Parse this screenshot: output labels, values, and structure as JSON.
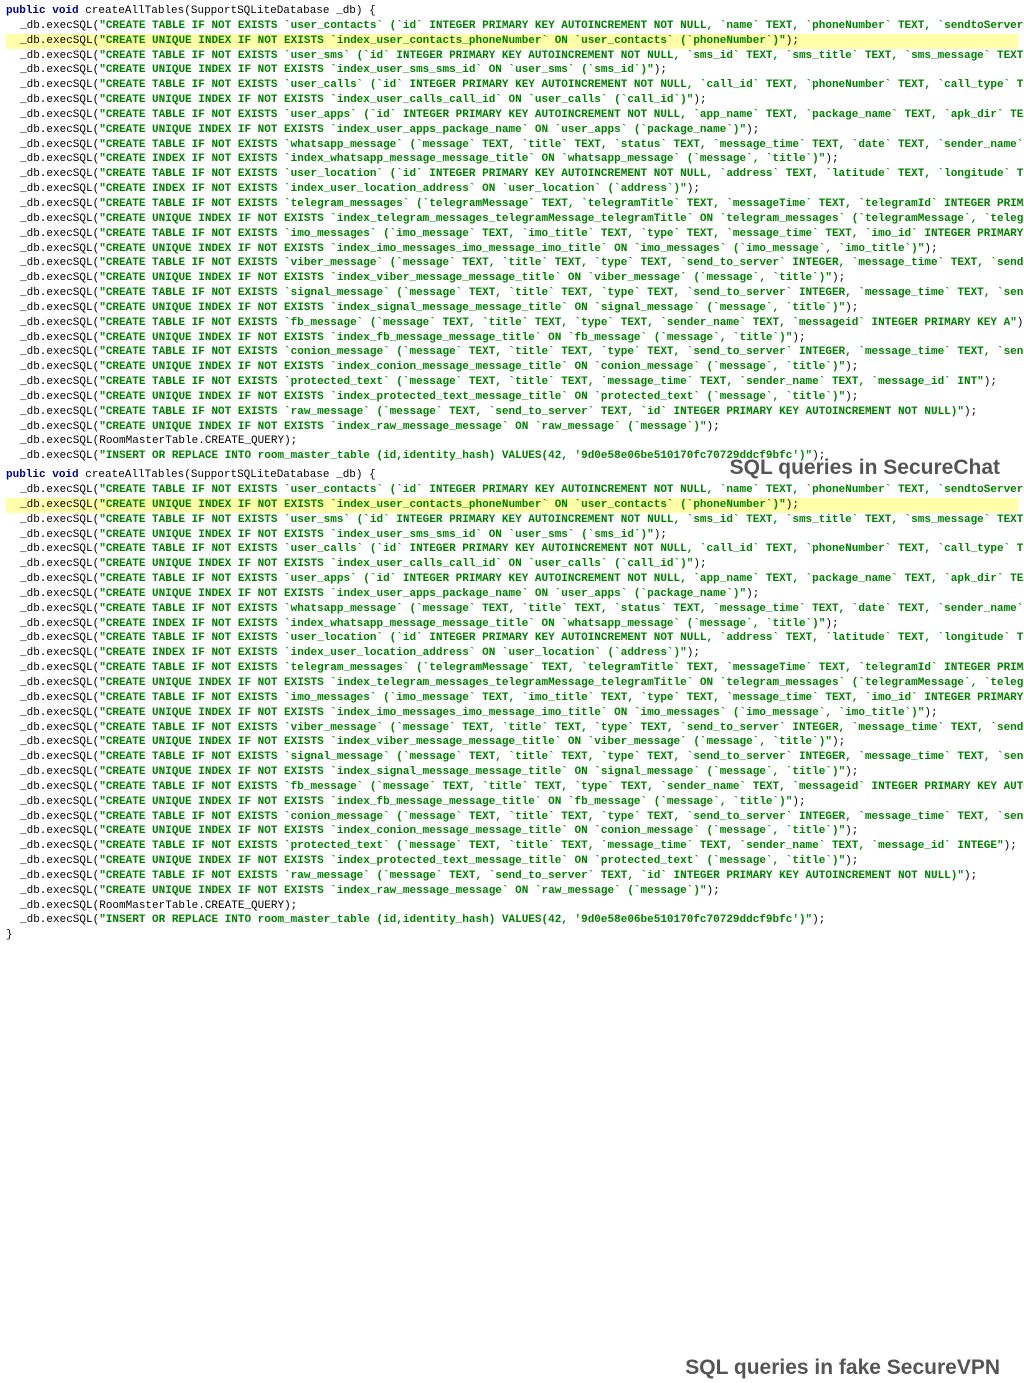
{
  "caption_top": "SQL queries in SecureChat",
  "caption_bottom": "SQL queries in fake SecureVPN",
  "method_signature": {
    "public": "public",
    "void": "void",
    "name": "createAllTables",
    "param_type": "SupportSQLiteDatabase",
    "param_name": "_db"
  },
  "db_call_prefix": "_db.execSQL(",
  "db_call_suffix": ");",
  "room_query": "RoomMasterTable.CREATE_QUERY",
  "lines_block1": [
    {
      "hl": false,
      "text": "CREATE TABLE IF NOT EXISTS `user_contacts` (`id` INTEGER PRIMARY KEY AUTOINCREMENT NOT NULL, `name` TEXT, `phoneNumber` TEXT, `sendtoServer` INTE"
    },
    {
      "hl": true,
      "text": "CREATE UNIQUE INDEX IF NOT EXISTS `index_user_contacts_phoneNumber` ON `user_contacts` (`phoneNumber`)"
    },
    {
      "hl": false,
      "text": "CREATE TABLE IF NOT EXISTS `user_sms` (`id` INTEGER PRIMARY KEY AUTOINCREMENT NOT NULL, `sms_id` TEXT, `sms_title` TEXT, `sms_message` TEXT, `sms"
    },
    {
      "hl": false,
      "text": "CREATE UNIQUE INDEX IF NOT EXISTS `index_user_sms_sms_id` ON `user_sms` (`sms_id`)"
    },
    {
      "hl": false,
      "text": "CREATE TABLE IF NOT EXISTS `user_calls` (`id` INTEGER PRIMARY KEY AUTOINCREMENT NOT NULL, `call_id` TEXT, `phoneNumber` TEXT, `call_type` TEXT, `"
    },
    {
      "hl": false,
      "text": "CREATE UNIQUE INDEX IF NOT EXISTS `index_user_calls_call_id` ON `user_calls` (`call_id`)"
    },
    {
      "hl": false,
      "text": "CREATE TABLE IF NOT EXISTS `user_apps` (`id` INTEGER PRIMARY KEY AUTOINCREMENT NOT NULL, `app_name` TEXT, `package_name` TEXT, `apk_dir` TEXT, `i"
    },
    {
      "hl": false,
      "text": "CREATE UNIQUE INDEX IF NOT EXISTS `index_user_apps_package_name` ON `user_apps` (`package_name`)"
    },
    {
      "hl": false,
      "text": "CREATE TABLE IF NOT EXISTS `whatsapp_message` (`message` TEXT, `title` TEXT, `status` TEXT, `message_time` TEXT, `date` TEXT, `sender_name` TEXT"
    },
    {
      "hl": false,
      "text": "CREATE INDEX IF NOT EXISTS `index_whatsapp_message_message_title` ON `whatsapp_message` (`message`, `title`)"
    },
    {
      "hl": false,
      "text": "CREATE TABLE IF NOT EXISTS `user_location` (`id` INTEGER PRIMARY KEY AUTOINCREMENT NOT NULL, `address` TEXT, `latitude` TEXT, `longitude` TEXT, `"
    },
    {
      "hl": false,
      "text": "CREATE INDEX IF NOT EXISTS `index_user_location_address` ON `user_location` (`address`)"
    },
    {
      "hl": false,
      "text": "CREATE TABLE IF NOT EXISTS `telegram_messages` (`telegramMessage` TEXT, `telegramTitle` TEXT, `messageTime` TEXT, `telegramId` INTEGER PRIMARY KE"
    },
    {
      "hl": false,
      "text": "CREATE UNIQUE INDEX IF NOT EXISTS `index_telegram_messages_telegramMessage_telegramTitle` ON `telegram_messages` (`telegramMessage`, `telegramTi"
    },
    {
      "hl": false,
      "text": "CREATE TABLE IF NOT EXISTS `imo_messages` (`imo_message` TEXT, `imo_title` TEXT, `type` TEXT, `message_time` TEXT, `imo_id` INTEGER PRIMARY KEY A"
    },
    {
      "hl": false,
      "text": "CREATE UNIQUE INDEX IF NOT EXISTS `index_imo_messages_imo_message_imo_title` ON `imo_messages` (`imo_message`, `imo_title`)"
    },
    {
      "hl": false,
      "text": "CREATE TABLE IF NOT EXISTS `viber_message` (`message` TEXT, `title` TEXT, `type` TEXT, `send_to_server` INTEGER, `message_time` TEXT, `sender_nam"
    },
    {
      "hl": false,
      "text": "CREATE UNIQUE INDEX IF NOT EXISTS `index_viber_message_message_title` ON `viber_message` (`message`, `title`)"
    },
    {
      "hl": false,
      "text": "CREATE TABLE IF NOT EXISTS `signal_message` (`message` TEXT, `title` TEXT, `type` TEXT, `send_to_server` INTEGER, `message_time` TEXT, `sender_na"
    },
    {
      "hl": false,
      "text": "CREATE UNIQUE INDEX IF NOT EXISTS `index_signal_message_message_title` ON `signal_message` (`message`, `title`)"
    },
    {
      "hl": false,
      "text": "CREATE TABLE IF NOT EXISTS `fb_message` (`message` TEXT, `title` TEXT, `type` TEXT, `sender_name` TEXT, `messageid` INTEGER PRIMARY KEY A"
    },
    {
      "hl": false,
      "text": "CREATE UNIQUE INDEX IF NOT EXISTS `index_fb_message_message_title` ON `fb_message` (`message`, `title`)"
    },
    {
      "hl": false,
      "text": "CREATE TABLE IF NOT EXISTS `conion_message` (`message` TEXT, `title` TEXT, `type` TEXT, `send_to_server` INTEGER, `message_time` TEXT, `sender_na"
    },
    {
      "hl": false,
      "text": "CREATE UNIQUE INDEX IF NOT EXISTS `index_conion_message_message_title` ON `conion_message` (`message`, `title`)"
    },
    {
      "hl": false,
      "text": "CREATE TABLE IF NOT EXISTS `protected_text` (`message` TEXT, `title` TEXT, `message_time` TEXT, `sender_name` TEXT, `message_id` INT"
    },
    {
      "hl": false,
      "text": "CREATE UNIQUE INDEX IF NOT EXISTS `index_protected_text_message_title` ON `protected_text` (`message`, `title`)"
    },
    {
      "hl": false,
      "text": "CREATE TABLE IF NOT EXISTS `raw_message` (`message` TEXT, `send_to_server` TEXT, `id` INTEGER PRIMARY KEY AUTOINCREMENT NOT NULL)"
    },
    {
      "hl": false,
      "text": "CREATE UNIQUE INDEX IF NOT EXISTS `index_raw_message_message` ON `raw_message` (`message`)"
    }
  ],
  "insert_line": "INSERT OR REPLACE INTO room_master_table (id,identity_hash) VALUES(42, '9d0e58e06be510170fc70729ddcf9bfc')",
  "lines_block2": [
    {
      "hl": false,
      "text": "CREATE TABLE IF NOT EXISTS `user_contacts` (`id` INTEGER PRIMARY KEY AUTOINCREMENT NOT NULL, `name` TEXT, `phoneNumber` TEXT, `sendtoServer` INTEGER"
    },
    {
      "hl": true,
      "text": "CREATE UNIQUE INDEX IF NOT EXISTS `index_user_contacts_phoneNumber` ON `user_contacts` (`phoneNumber`)"
    },
    {
      "hl": false,
      "text": "CREATE TABLE IF NOT EXISTS `user_sms` (`id` INTEGER PRIMARY KEY AUTOINCREMENT NOT NULL, `sms_id` TEXT, `sms_title` TEXT, `sms_message` TEXT, `sms_ti"
    },
    {
      "hl": false,
      "text": "CREATE UNIQUE INDEX IF NOT EXISTS `index_user_sms_sms_id` ON `user_sms` (`sms_id`)"
    },
    {
      "hl": false,
      "text": "CREATE TABLE IF NOT EXISTS `user_calls` (`id` INTEGER PRIMARY KEY AUTOINCREMENT NOT NULL, `call_id` TEXT, `phoneNumber` TEXT, `call_type` TEXT, `cal"
    },
    {
      "hl": false,
      "text": "CREATE UNIQUE INDEX IF NOT EXISTS `index_user_calls_call_id` ON `user_calls` (`call_id`)"
    },
    {
      "hl": false,
      "text": "CREATE TABLE IF NOT EXISTS `user_apps` (`id` INTEGER PRIMARY KEY AUTOINCREMENT NOT NULL, `app_name` TEXT, `package_name` TEXT, `apk_dir` TEXT, `icon"
    },
    {
      "hl": false,
      "text": "CREATE UNIQUE INDEX IF NOT EXISTS `index_user_apps_package_name` ON `user_apps` (`package_name`)"
    },
    {
      "hl": false,
      "text": "CREATE TABLE IF NOT EXISTS `whatsapp_message` (`message` TEXT, `title` TEXT, `status` TEXT, `message_time` TEXT, `date` TEXT, `sender_name` TEXT, `m"
    },
    {
      "hl": false,
      "text": "CREATE INDEX IF NOT EXISTS `index_whatsapp_message_message_title` ON `whatsapp_message` (`message`, `title`)"
    },
    {
      "hl": false,
      "text": "CREATE TABLE IF NOT EXISTS `user_location` (`id` INTEGER PRIMARY KEY AUTOINCREMENT NOT NULL, `address` TEXT, `latitude` TEXT, `longitude` TEXT, `loc"
    },
    {
      "hl": false,
      "text": "CREATE INDEX IF NOT EXISTS `index_user_location_address` ON `user_location` (`address`)"
    },
    {
      "hl": false,
      "text": "CREATE TABLE IF NOT EXISTS `telegram_messages` (`telegramMessage` TEXT, `telegramTitle` TEXT, `messageTime` TEXT, `telegramId` INTEGER PRIMARY KEY A"
    },
    {
      "hl": false,
      "text": "CREATE UNIQUE INDEX IF NOT EXISTS `index_telegram_messages_telegramMessage_telegramTitle` ON `telegram_messages` (`telegramMessage`, `telegramTitle"
    },
    {
      "hl": false,
      "text": "CREATE TABLE IF NOT EXISTS `imo_messages` (`imo_message` TEXT, `imo_title` TEXT, `type` TEXT, `message_time` TEXT, `imo_id` INTEGER PRIMARY KEY AUTO"
    },
    {
      "hl": false,
      "text": "CREATE UNIQUE INDEX IF NOT EXISTS `index_imo_messages_imo_message_imo_title` ON `imo_messages` (`imo_message`, `imo_title`)"
    },
    {
      "hl": false,
      "text": "CREATE TABLE IF NOT EXISTS `viber_message` (`message` TEXT, `title` TEXT, `type` TEXT, `send_to_server` INTEGER, `message_time` TEXT, `sender_name` "
    },
    {
      "hl": false,
      "text": "CREATE UNIQUE INDEX IF NOT EXISTS `index_viber_message_message_title` ON `viber_message` (`message`, `title`)"
    },
    {
      "hl": false,
      "text": "CREATE TABLE IF NOT EXISTS `signal_message` (`message` TEXT, `title` TEXT, `type` TEXT, `send_to_server` INTEGER, `message_time` TEXT, `sender_name`"
    },
    {
      "hl": false,
      "text": "CREATE UNIQUE INDEX IF NOT EXISTS `index_signal_message_message_title` ON `signal_message` (`message`, `title`)"
    },
    {
      "hl": false,
      "text": "CREATE TABLE IF NOT EXISTS `fb_message` (`message` TEXT, `title` TEXT, `type` TEXT, `sender_name` TEXT, `messageid` INTEGER PRIMARY KEY AUTO"
    },
    {
      "hl": false,
      "text": "CREATE UNIQUE INDEX IF NOT EXISTS `index_fb_message_message_title` ON `fb_message` (`message`, `title`)"
    },
    {
      "hl": false,
      "text": "CREATE TABLE IF NOT EXISTS `conion_message` (`message` TEXT, `title` TEXT, `type` TEXT, `send_to_server` INTEGER, `message_time` TEXT, `sender_name`"
    },
    {
      "hl": false,
      "text": "CREATE UNIQUE INDEX IF NOT EXISTS `index_conion_message_message_title` ON `conion_message` (`message`, `title`)"
    },
    {
      "hl": false,
      "text": "CREATE TABLE IF NOT EXISTS `protected_text` (`message` TEXT, `title` TEXT, `message_time` TEXT, `sender_name` TEXT, `message_id` INTEGE"
    },
    {
      "hl": false,
      "text": "CREATE UNIQUE INDEX IF NOT EXISTS `index_protected_text_message_title` ON `protected_text` (`message`, `title`)"
    },
    {
      "hl": false,
      "text": "CREATE TABLE IF NOT EXISTS `raw_message` (`message` TEXT, `send_to_server` TEXT, `id` INTEGER PRIMARY KEY AUTOINCREMENT NOT NULL)"
    },
    {
      "hl": false,
      "text": "CREATE UNIQUE INDEX IF NOT EXISTS `index_raw_message_message` ON `raw_message` (`message`)"
    }
  ]
}
